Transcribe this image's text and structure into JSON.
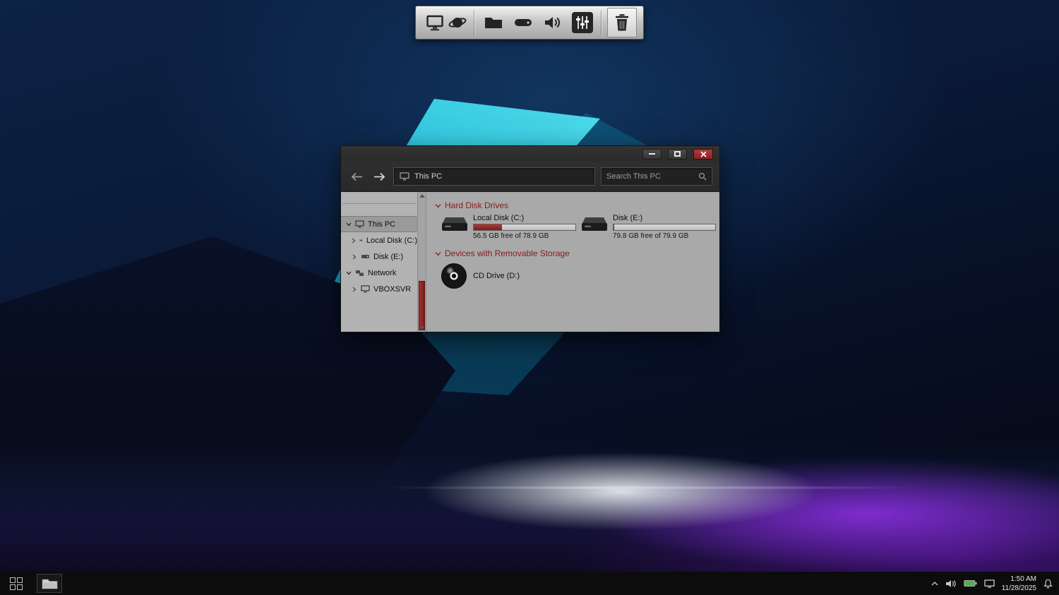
{
  "dock": {
    "icons": [
      "display-icon",
      "globe-icon",
      "folder-icon",
      "drive-icon",
      "volume-icon",
      "mixer-icon",
      "trash-icon"
    ]
  },
  "window": {
    "address": {
      "text": "This PC",
      "icon": "computer-icon"
    },
    "search": {
      "placeholder": "Search This PC",
      "icon": "search-icon"
    },
    "sidebar": {
      "items": [
        {
          "label": "This PC",
          "icon": "computer-icon",
          "expander": "down",
          "selected": true
        },
        {
          "label": "Local Disk (C:)",
          "icon": "drive-icon",
          "expander": "right"
        },
        {
          "label": "Disk (E:)",
          "icon": "drive-icon",
          "expander": "right"
        },
        {
          "label": "Network",
          "icon": "network-icon",
          "expander": "down"
        },
        {
          "label": "VBOXSVR",
          "icon": "computer-icon",
          "expander": "right"
        }
      ]
    },
    "sections": [
      {
        "title": "Hard Disk Drives",
        "items": [
          {
            "label": "Local Disk (C:)",
            "icon": "hard-drive-icon",
            "free_text": "56.5 GB free of 78.9 GB",
            "used_percent": 28
          },
          {
            "label": "Disk (E:)",
            "icon": "hard-drive-icon",
            "free_text": "79.8 GB free of 79.9 GB",
            "used_percent": 1
          }
        ]
      },
      {
        "title": "Devices with Removable Storage",
        "items": [
          {
            "label": "CD Drive (D:)",
            "icon": "cd-icon"
          }
        ]
      }
    ]
  },
  "taskbar": {
    "start_icon": "start-grid-icon",
    "apps": [
      "file-explorer-icon"
    ],
    "tray": {
      "icons": [
        "chevron-up-icon",
        "volume-icon",
        "battery-icon",
        "display-icon",
        "bell-icon"
      ],
      "time": "1:50 AM",
      "date": "11/28/2025"
    }
  },
  "colors": {
    "accent_red": "#8a1a1a",
    "titlebar": "#2d2d2d",
    "content_bg": "#a9a9a9",
    "sidebar_bg": "#b3b3b3",
    "taskbar_bg": "#0c0c0c",
    "close_button": "#8a2222",
    "battery_green": "#4fae4f"
  }
}
